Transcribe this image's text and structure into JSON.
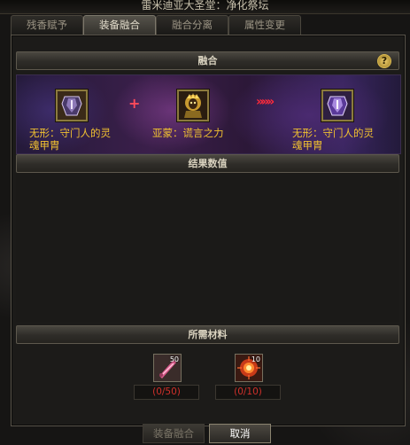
{
  "window": {
    "title": "雷米迪亚大圣堂：净化祭坛"
  },
  "tabs": [
    {
      "label": "残香赋予",
      "active": false
    },
    {
      "label": "装备融合",
      "active": true
    },
    {
      "label": "融合分离",
      "active": false
    },
    {
      "label": "属性变更",
      "active": false
    }
  ],
  "fusion": {
    "header": "融合",
    "help_icon": "?",
    "item_left": {
      "name_line1": "无形：守门人的灵",
      "name_line2": "魂甲胄",
      "icon": "armor-icon"
    },
    "plus": "+",
    "item_mid": {
      "name": "亚蒙：谎言之力",
      "icon": "amon-power-icon"
    },
    "arrows": "»»»",
    "item_right": {
      "name_line1": "无形：守门人的灵",
      "name_line2": "魂甲胄",
      "icon": "armor-result-icon"
    }
  },
  "result": {
    "header": "结果数值"
  },
  "materials": {
    "header": "所需材料",
    "items": [
      {
        "icon": "pink-crystal-icon",
        "stack": "50",
        "count": "(0/50)"
      },
      {
        "icon": "fire-orb-icon",
        "stack": "10",
        "count": "(0/10)"
      }
    ]
  },
  "buttons": {
    "fuse": "装备融合",
    "cancel": "取消"
  },
  "colors": {
    "item_name": "#f0c030",
    "missing_count": "#d0302a",
    "plus": "#ff4a5a"
  }
}
